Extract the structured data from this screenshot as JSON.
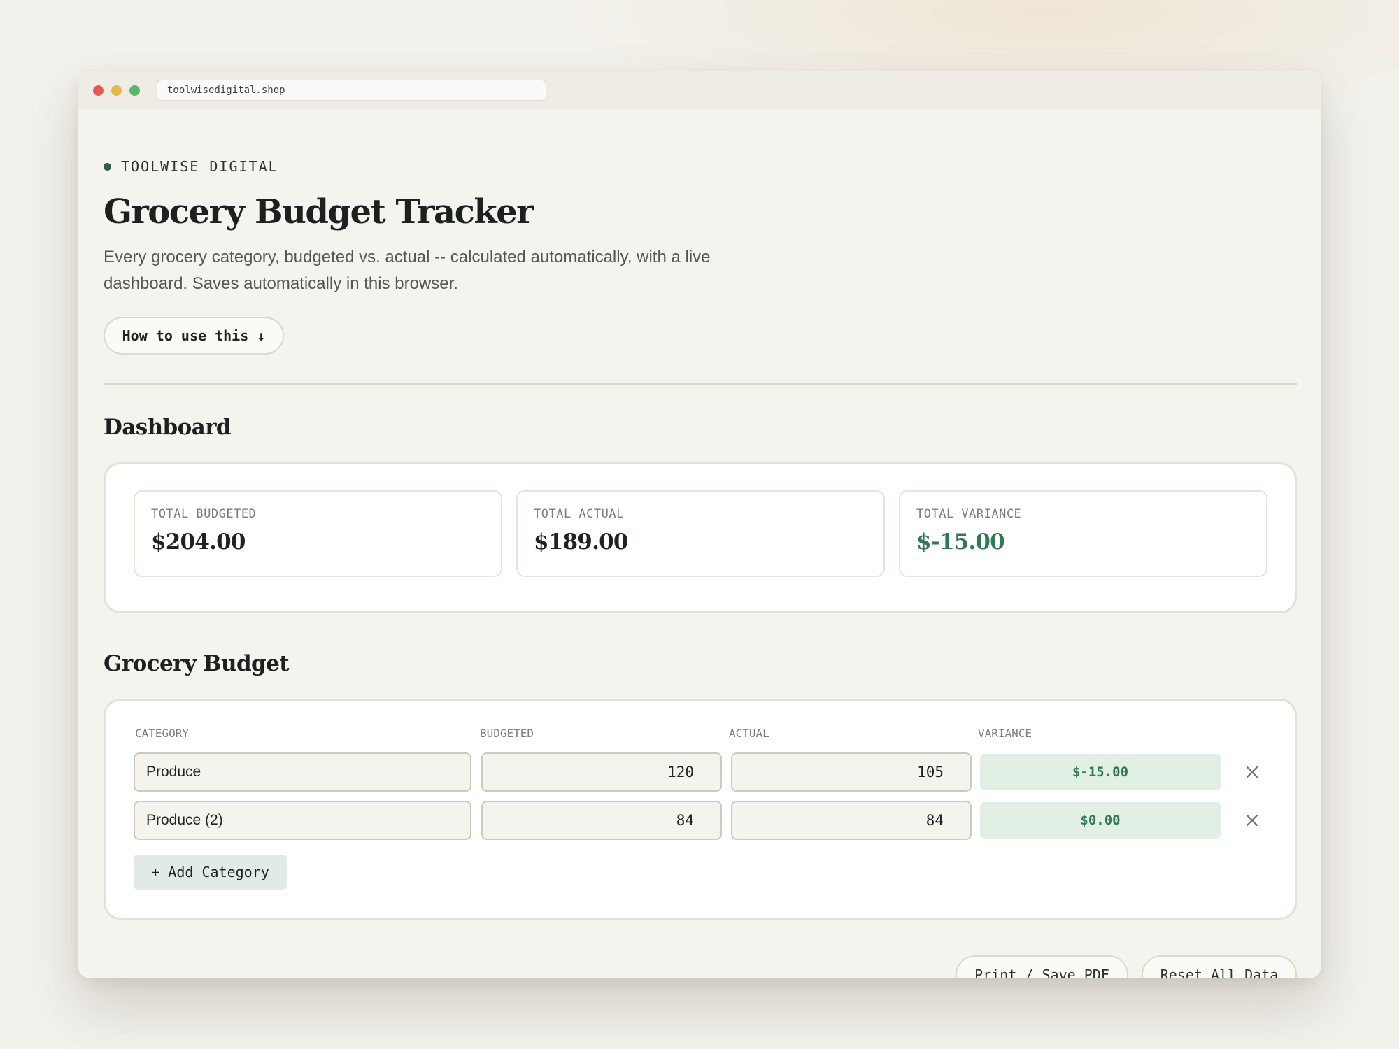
{
  "browser": {
    "url": "toolwisedigital.shop"
  },
  "header": {
    "brand": "TOOLWISE DIGITAL",
    "title": "Grocery Budget Tracker",
    "subtitle": "Every grocery category, budgeted vs. actual -- calculated automatically, with a live dashboard. Saves automatically in this browser.",
    "how_to_label": "How to use this ↓"
  },
  "dashboard": {
    "title": "Dashboard",
    "stats": [
      {
        "label": "TOTAL BUDGETED",
        "value": "$204.00"
      },
      {
        "label": "TOTAL ACTUAL",
        "value": "$189.00"
      },
      {
        "label": "TOTAL VARIANCE",
        "value": "$-15.00"
      }
    ]
  },
  "budget": {
    "title": "Grocery Budget",
    "columns": [
      "CATEGORY",
      "BUDGETED",
      "ACTUAL",
      "VARIANCE"
    ],
    "rows": [
      {
        "category": "Produce",
        "budgeted": "120",
        "actual": "105",
        "variance": "$-15.00"
      },
      {
        "category": "Produce (2)",
        "budgeted": "84",
        "actual": "84",
        "variance": "$0.00"
      }
    ],
    "add_label": "+ Add Category"
  },
  "footer": {
    "print_label": "Print / Save PDF",
    "reset_label": "Reset All Data"
  },
  "colors": {
    "accent": "#2e5e4e",
    "positive": "#2f7a55",
    "variance_bg": "#e1efe5",
    "page_bg": "#f5f3ee"
  },
  "icons": {
    "remove": "close-icon",
    "brand": "status-dot-icon"
  }
}
